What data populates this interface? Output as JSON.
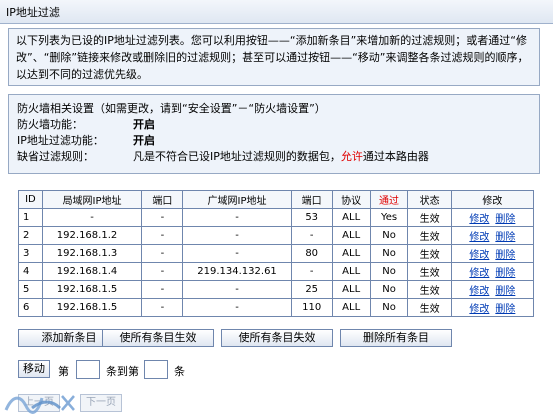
{
  "title": "IP地址过滤",
  "intro": "以下列表为已设的IP地址过滤列表。您可以利用按钮——“添加新条目”来增加新的过滤规则；或者通过“修改”、“删除”链接来修改或删除旧的过滤规则；甚至可以通过按钮——“移动”来调整各条过滤规则的顺序，以达到不同的过滤优先级。",
  "firewall": {
    "header": "防火墙相关设置（如需更改，请到“安全设置”－“防火墙设置”）",
    "fw_label": "防火墙功能：",
    "fw_value": "开启",
    "ipf_label": "IP地址过滤功能：",
    "ipf_value": "开启",
    "default_label": "缺省过滤规则：",
    "default_pre": "凡是不符合已设IP地址过滤规则的数据包，",
    "default_highlight": "允许",
    "default_post": "通过本路由器"
  },
  "table": {
    "headers": [
      "ID",
      "局域网IP地址",
      "端口",
      "广域网IP地址",
      "端口",
      "协议",
      "通过",
      "状态",
      "修改"
    ],
    "rows": [
      [
        "1",
        "-",
        "-",
        "-",
        "53",
        "ALL",
        "Yes",
        "生效"
      ],
      [
        "2",
        "192.168.1.2",
        "-",
        "-",
        "-",
        "ALL",
        "No",
        "生效"
      ],
      [
        "3",
        "192.168.1.3",
        "-",
        "-",
        "80",
        "ALL",
        "No",
        "生效"
      ],
      [
        "4",
        "192.168.1.4",
        "-",
        "219.134.132.61",
        "-",
        "ALL",
        "No",
        "生效"
      ],
      [
        "5",
        "192.168.1.5",
        "-",
        "-",
        "25",
        "ALL",
        "No",
        "生效"
      ],
      [
        "6",
        "192.168.1.5",
        "-",
        "-",
        "110",
        "ALL",
        "No",
        "生效"
      ]
    ],
    "edit_label": "修改",
    "delete_label": "删除"
  },
  "buttons": {
    "add": "添加新条目",
    "enable_all": "使所有条目生效",
    "disable_all": "使所有条目失效",
    "delete_all": "删除所有条目"
  },
  "move": {
    "button": "移动",
    "from_prefix": "第",
    "to_text": "条到第",
    "suffix": "条",
    "from_value": "",
    "to_value": ""
  },
  "nav": {
    "prev": "上一页",
    "next": "下一页"
  },
  "colors": {
    "panel_bg": "#eef3fa",
    "border": "#6f86ad",
    "link": "#003bb5",
    "highlight_red": "#e00000"
  }
}
